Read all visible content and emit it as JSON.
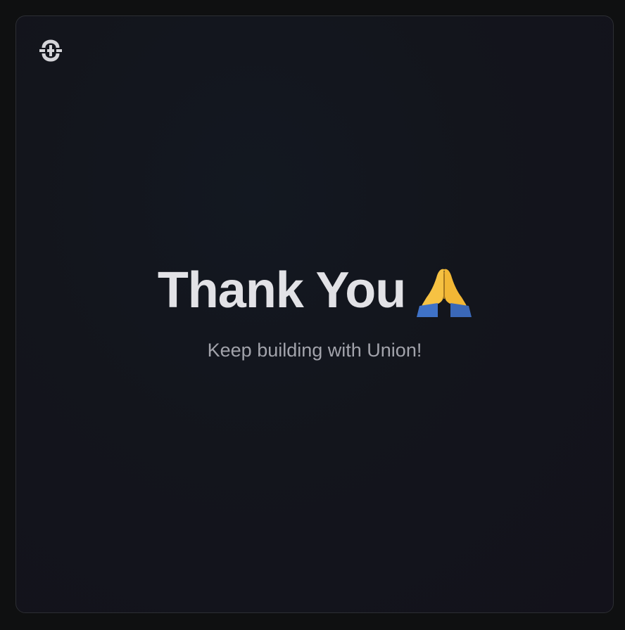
{
  "brand": {
    "logo_icon": "union-logo-icon"
  },
  "main": {
    "title": "Thank You",
    "title_icon": "folded-hands-icon",
    "subtitle": "Keep building with Union!"
  },
  "colors": {
    "background": "#0f1011",
    "card_border": "#2c2e33",
    "title_text": "#e2e2e6",
    "subtitle_text": "#a2a3ab"
  }
}
